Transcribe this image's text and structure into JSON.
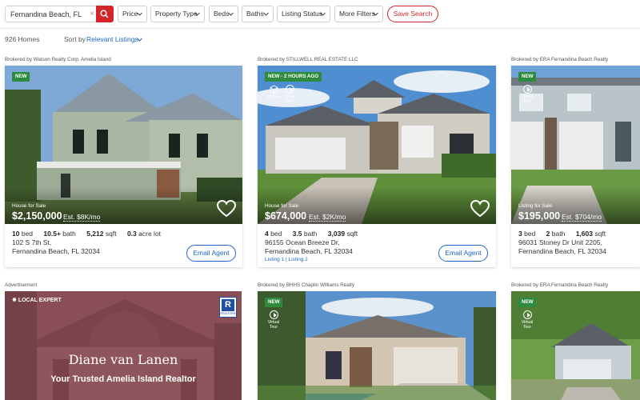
{
  "search": {
    "value": "Fernandina Beach, FL",
    "clear_glyph": "×",
    "button_icon": "search-icon"
  },
  "filters": [
    {
      "label": "Price"
    },
    {
      "label": "Property Type"
    },
    {
      "label": "Beds"
    },
    {
      "label": "Baths"
    },
    {
      "label": "Listing Status"
    },
    {
      "label": "More Filters"
    }
  ],
  "save_search_label": "Save Search",
  "results": {
    "count": "926 Homes",
    "sort_label": "Sort by",
    "sort_value": "Relevant Listings"
  },
  "listings": [
    {
      "broker": "Brokered by Watson Realty Corp. Amelia Island",
      "badge": "NEW",
      "status": "House for Sale",
      "price": "$2,150,000",
      "estimate": "Est. $8K/mo",
      "stats": [
        {
          "value": "10",
          "unit": "bed"
        },
        {
          "value": "10.5+",
          "unit": "bath"
        },
        {
          "value": "5,212",
          "unit": "sqft"
        },
        {
          "value": "0.3",
          "unit": "acre lot"
        }
      ],
      "address1": "102 S 7th St,",
      "address2": "Fernandina Beach, FL 32034",
      "email_label": "Email Agent"
    },
    {
      "broker": "Brokered by STILLWELL REAL ESTATE LLC",
      "badge": "NEW - 2 HOURS AGO",
      "tour_3d": "3D Tour",
      "tour_virtual": "Virtual Tour",
      "status": "House for Sale",
      "price": "$674,000",
      "estimate": "Est. $2K/mo",
      "stats": [
        {
          "value": "4",
          "unit": "bed"
        },
        {
          "value": "3.5",
          "unit": "bath"
        },
        {
          "value": "3,039",
          "unit": "sqft"
        }
      ],
      "address1": "96155 Ocean Breeze Dr,",
      "address2": "Fernandina Beach, FL 32034",
      "links": "Listing 1 | Listing 2",
      "email_label": "Email Agent"
    },
    {
      "broker": "Brokered by ERA Fernandina Beach Realty",
      "badge": "NEW",
      "tour_virtual": "Virtual Tour",
      "status": "Listing for Sale",
      "price": "$195,000",
      "estimate": "Est. $704/mo",
      "stats": [
        {
          "value": "3",
          "unit": "bed"
        },
        {
          "value": "2",
          "unit": "bath"
        },
        {
          "value": "1,603",
          "unit": "sqft"
        }
      ],
      "address1": "96031 Stoney Dr Unit 2205,",
      "address2": "Fernandina Beach, FL 32034"
    }
  ],
  "row2": {
    "ad_label": "Advertisement",
    "ad_tag": "LOCAL EXPERT",
    "ad_realtor_mark": "R",
    "ad_realtor_text": "REALTOR®",
    "ad_name": "Diane van Lanen",
    "ad_subtitle": "Your Trusted Amelia Island Realtor",
    "card2_broker": "Brokered by BHHS Chaplin Williams Realty",
    "card2_badge": "NEW",
    "card2_tour": "Virtual Tour",
    "card3_broker": "Brokered by ERA Fernandina Beach Realty",
    "card3_badge": "NEW",
    "card3_tour": "Virtual Tour"
  },
  "colors": {
    "accent_red": "#d4252b",
    "link_blue": "#1e66c7",
    "new_badge_green": "#2e8b3d"
  }
}
